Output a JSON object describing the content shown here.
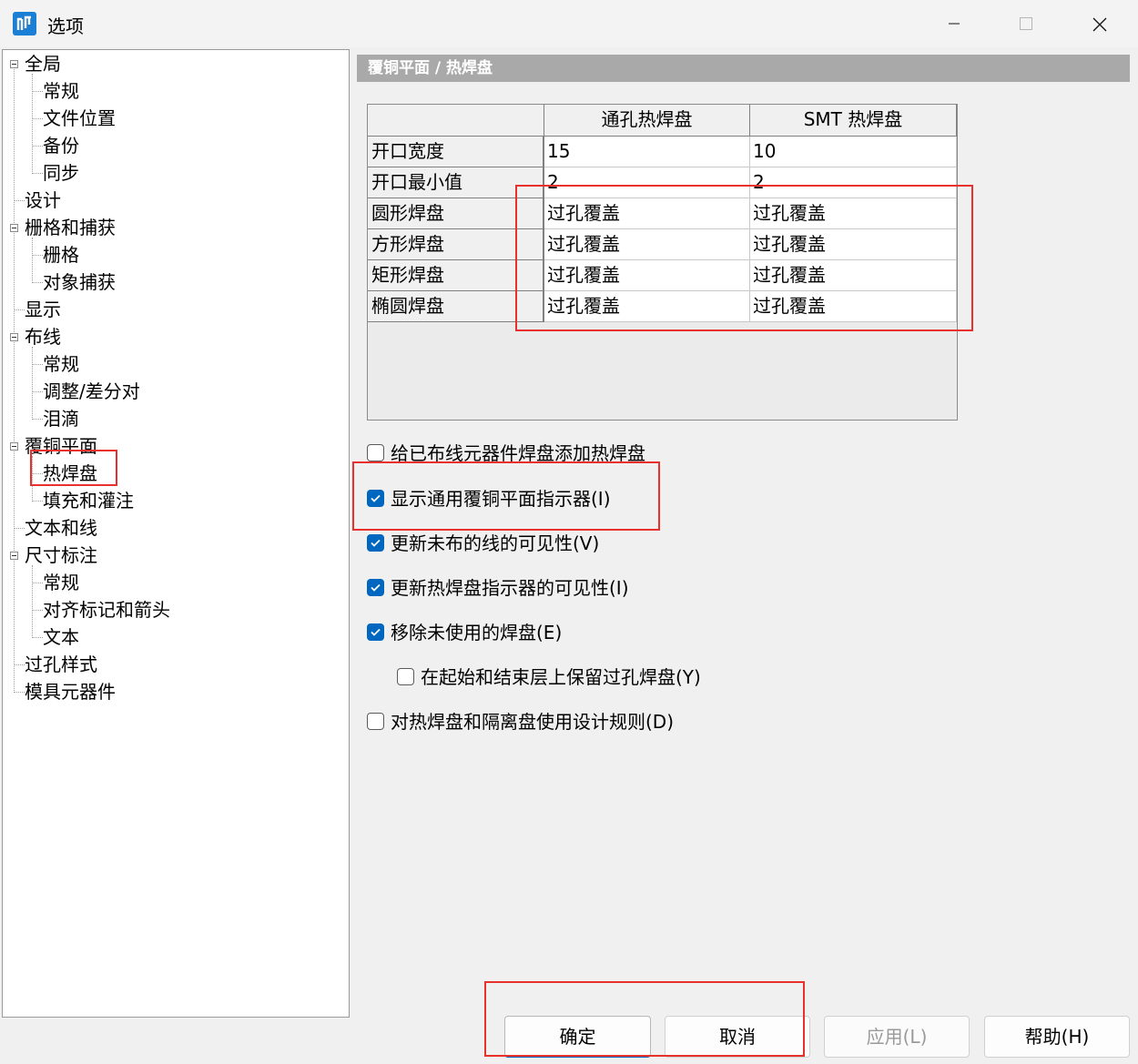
{
  "window": {
    "title": "选项",
    "icon": "app-icon",
    "controls": [
      "minimize-icon",
      "maximize-icon",
      "close-icon"
    ]
  },
  "tree": {
    "nodes": [
      "全局",
      "常规",
      "文件位置",
      "备份",
      "同步",
      "设计",
      "栅格和捕获",
      "栅格",
      "对象捕获",
      "显示",
      "布线",
      "常规",
      "调整/差分对",
      "泪滴",
      "覆铜平面",
      "热焊盘",
      "填充和灌注",
      "文本和线",
      "尺寸标注",
      "常规",
      "对齐标记和箭头",
      "文本",
      "过孔样式",
      "模具元器件"
    ],
    "selected": "热焊盘"
  },
  "panel": {
    "header": "覆铜平面 / 热焊盘"
  },
  "grid": {
    "columns": [
      "",
      "通孔热焊盘",
      "SMT 热焊盘"
    ],
    "rows": [
      {
        "label": "开口宽度",
        "values": [
          "15",
          "10"
        ]
      },
      {
        "label": "开口最小值",
        "values": [
          "2",
          "2"
        ]
      },
      {
        "label": "圆形焊盘",
        "values": [
          "过孔覆盖",
          "过孔覆盖"
        ]
      },
      {
        "label": "方形焊盘",
        "values": [
          "过孔覆盖",
          "过孔覆盖"
        ]
      },
      {
        "label": "矩形焊盘",
        "values": [
          "过孔覆盖",
          "过孔覆盖"
        ]
      },
      {
        "label": "椭圆焊盘",
        "values": [
          "过孔覆盖",
          "过孔覆盖"
        ]
      }
    ]
  },
  "options": [
    {
      "label": "给已布线元器件焊盘添加热焊盘",
      "checked": false
    },
    {
      "label": "显示通用覆铜平面指示器(I)",
      "checked": true
    },
    {
      "label": "更新未布的线的可见性(V)",
      "checked": true
    },
    {
      "label": "更新热焊盘指示器的可见性(I)",
      "checked": true
    },
    {
      "label": "移除未使用的焊盘(E)",
      "checked": true
    },
    {
      "label": "在起始和结束层上保留过孔焊盘(Y)",
      "checked": false
    },
    {
      "label": "对热焊盘和隔离盘使用设计规则(D)",
      "checked": false
    }
  ],
  "buttons": {
    "ok": "确定",
    "cancel": "取消",
    "apply": "应用(L)",
    "help": "帮助(H)"
  },
  "colors": {
    "accent": "#0067c0",
    "annotation": "#e8302c",
    "header_bg": "#a9a9a9"
  }
}
